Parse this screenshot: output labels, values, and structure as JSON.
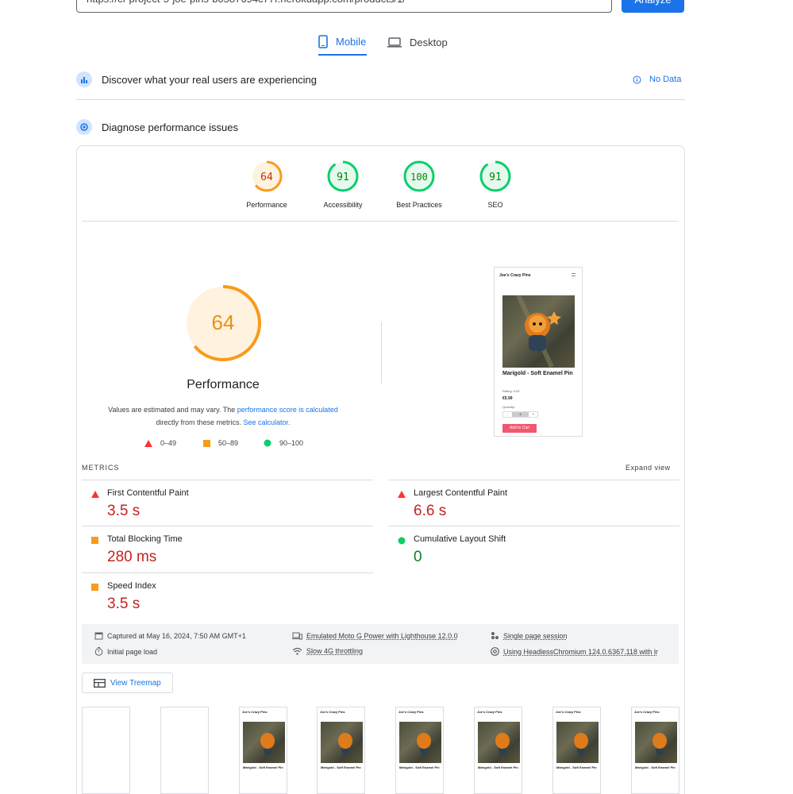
{
  "top": {
    "url": "https://cf-project-5-joe-pins-b0587694c77f.herokuapp.com/products/1/",
    "analyze_label": "Analyze"
  },
  "tabs": [
    {
      "label": "Mobile",
      "icon": "smartphone-icon",
      "selected": true
    },
    {
      "label": "Desktop",
      "icon": "laptop-icon",
      "selected": false
    }
  ],
  "field_data": {
    "title": "Discover what your real users are experiencing",
    "status": "No Data"
  },
  "lab_data": {
    "title": "Diagnose performance issues"
  },
  "categories": [
    {
      "label": "Performance",
      "score": "64",
      "color": "#fa9a1b"
    },
    {
      "label": "Accessibility",
      "score": "91",
      "color": "#0cce6b"
    },
    {
      "label": "Best Practices",
      "score": "100",
      "color": "#0cce6b"
    },
    {
      "label": "SEO",
      "score": "91",
      "color": "#0cce6b"
    }
  ],
  "performance": {
    "score": "64",
    "title": "Performance",
    "note_prefix": "Values are estimated and may vary. The ",
    "note_link1": "performance score is calculated",
    "note_middle": "directly from these metrics. ",
    "note_link2": "See calculator.",
    "legend": [
      {
        "range": "0–49",
        "shape": "triangle",
        "color": "#ff3333"
      },
      {
        "range": "50–89",
        "shape": "square",
        "color": "#fa9a1b"
      },
      {
        "range": "90–100",
        "shape": "circle",
        "color": "#0cce6b"
      }
    ]
  },
  "screenshot": {
    "site_name": "Joe's Crazy Pins",
    "product_title": "Marigold - Soft Enamel Pin",
    "rating": "Rating: 5.00",
    "price": "€5.99",
    "quantity_label": "Quantity:",
    "qty_minus": "-",
    "qty_value": "1",
    "qty_plus": "+",
    "cart_label": "Add to Cart"
  },
  "metrics": {
    "title": "METRICS",
    "expand_label": "Expand view",
    "items": [
      {
        "label": "First Contentful Paint",
        "value": "3.5 s",
        "status": "fail"
      },
      {
        "label": "Largest Contentful Paint",
        "value": "6.6 s",
        "status": "fail"
      },
      {
        "label": "Total Blocking Time",
        "value": "280 ms",
        "status": "average"
      },
      {
        "label": "Cumulative Layout Shift",
        "value": "0",
        "status": "pass"
      },
      {
        "label": "Speed Index",
        "value": "3.5 s",
        "status": "average"
      }
    ]
  },
  "runtime_info": {
    "captured": "Captured at May 16, 2024, 7:50 AM GMT+1",
    "device": "Emulated Moto G Power with Lighthouse 12.0.0",
    "session": "Single page session",
    "load": "Initial page load",
    "throttling": "Slow 4G throttling",
    "browser": "Using HeadlessChromium 124.0.6367.118 with lr"
  },
  "treemap_label": "View Treemap",
  "colors": {
    "accent": "#1a73e8",
    "fail": "#c5221f",
    "average": "#fa9a1b",
    "pass": "#0cce6b"
  }
}
